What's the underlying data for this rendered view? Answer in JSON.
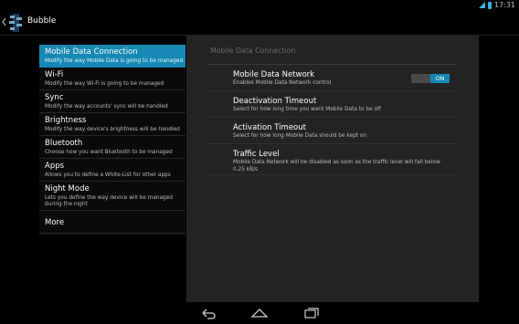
{
  "status": {
    "time": "17:31"
  },
  "app": {
    "title": "Bubble"
  },
  "sidebar": {
    "items": [
      {
        "title": "Mobile Data Connection",
        "subtitle": "Modify the way Mobile Data is going to be managed"
      },
      {
        "title": "Wi-Fi",
        "subtitle": "Modify the way Wi-Fi is going to be managed"
      },
      {
        "title": "Sync",
        "subtitle": "Modify the way accounts' sync will be handled"
      },
      {
        "title": "Brightness",
        "subtitle": "Modify the way device's brightness will be handled"
      },
      {
        "title": "Bluetooth",
        "subtitle": "Choose how you want Bluetooth to be managed"
      },
      {
        "title": "Apps",
        "subtitle": "Allows you to define a White-List for other apps"
      },
      {
        "title": "Night Mode",
        "subtitle": "Lets you define the way device will be managed during the night"
      },
      {
        "title": "More"
      }
    ]
  },
  "detail": {
    "heading": "Mobile Data Connection",
    "prefs": [
      {
        "title": "Mobile Data Network",
        "subtitle": "Enables Mobile Data Network control",
        "toggle_label": "ON"
      },
      {
        "title": "Deactivation Timeout",
        "subtitle": "Select for how long time you want Mobile Data to be off"
      },
      {
        "title": "Activation Timeout",
        "subtitle": "Select for how long Mobile Data should be kept on"
      },
      {
        "title": "Traffic Level",
        "subtitle": "Mobile Data Network will be disabled as soon as the traffic level will fall below 0.25 kB/s"
      }
    ]
  },
  "icons": {
    "back": "back-icon",
    "home": "home-icon",
    "recents": "recents-icon"
  },
  "colors": {
    "accent": "#1688b3",
    "panel": "#232323"
  }
}
